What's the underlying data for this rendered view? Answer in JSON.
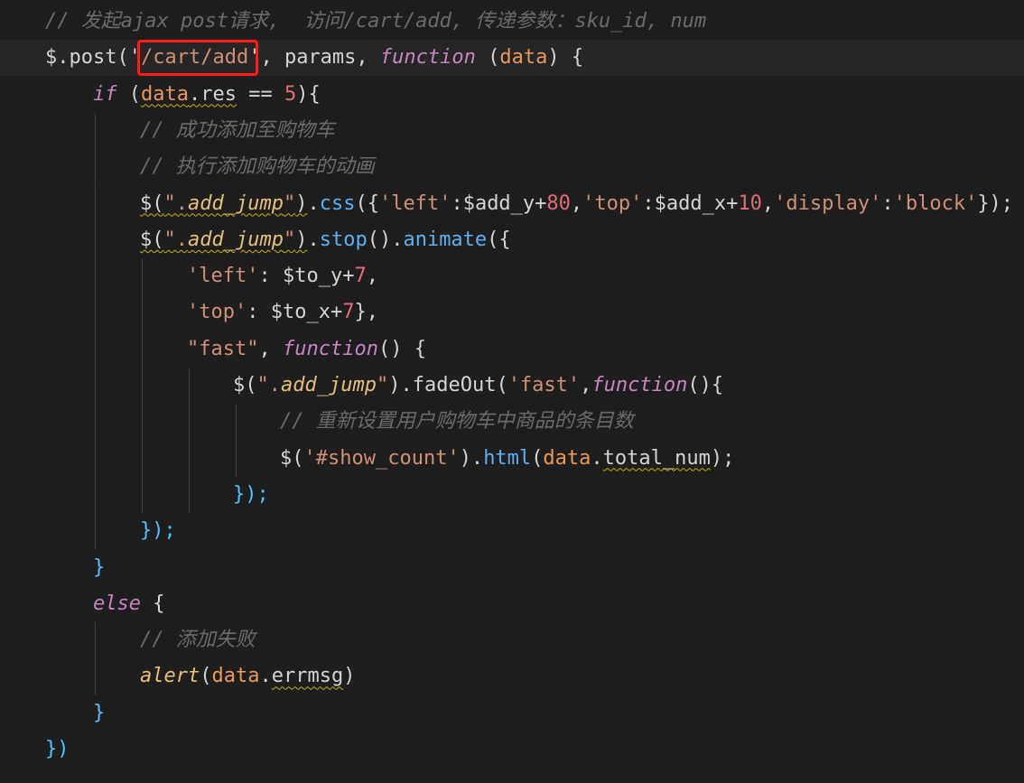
{
  "editor": {
    "highlighted_text": "/cart/add",
    "lines": [
      {
        "indent": 1,
        "tokens": [
          {
            "t": "// 发起ajax post请求,  访问/cart/add, 传递参数：sku_id, num",
            "c": "comment"
          }
        ]
      },
      {
        "indent": 1,
        "current": true,
        "tokens": [
          {
            "t": "$.",
            "c": "plain"
          },
          {
            "t": "post",
            "c": "plain"
          },
          {
            "t": "('",
            "c": "punct"
          },
          {
            "t": "/cart/add",
            "c": "string"
          },
          {
            "t": "'",
            "c": "punct"
          },
          {
            "t": ", params, ",
            "c": "plain"
          },
          {
            "t": "function",
            "c": "func-kw"
          },
          {
            "t": " (",
            "c": "plain"
          },
          {
            "t": "data",
            "c": "param"
          },
          {
            "t": ") {",
            "c": "plain"
          }
        ]
      },
      {
        "indent": 2,
        "tokens": [
          {
            "t": "if",
            "c": "keyword"
          },
          {
            "t": " (",
            "c": "plain"
          },
          {
            "t": "data",
            "c": "param",
            "sq": true
          },
          {
            "t": ".",
            "c": "plain",
            "sq": true
          },
          {
            "t": "res",
            "c": "plain",
            "sq": true
          },
          {
            "t": " == ",
            "c": "op"
          },
          {
            "t": "5",
            "c": "number"
          },
          {
            "t": "){",
            "c": "plain"
          }
        ]
      },
      {
        "indent": 3,
        "tokens": [
          {
            "t": "// 成功添加至购物车",
            "c": "comment"
          }
        ]
      },
      {
        "indent": 3,
        "tokens": [
          {
            "t": "// 执行添加购物车的动画",
            "c": "comment"
          }
        ]
      },
      {
        "indent": 3,
        "tokens": [
          {
            "t": "$(",
            "c": "plain",
            "sq": true
          },
          {
            "t": "\".",
            "c": "string",
            "sq": true
          },
          {
            "t": "add_jump",
            "c": "selector",
            "sq": true
          },
          {
            "t": "\"",
            "c": "string",
            "sq": true
          },
          {
            "t": ")",
            "c": "plain",
            "sq": true
          },
          {
            "t": ".",
            "c": "plain"
          },
          {
            "t": "css",
            "c": "method"
          },
          {
            "t": "({",
            "c": "plain"
          },
          {
            "t": "'left'",
            "c": "string"
          },
          {
            "t": ":$add_y+",
            "c": "plain"
          },
          {
            "t": "80",
            "c": "number"
          },
          {
            "t": ",",
            "c": "plain"
          },
          {
            "t": "'top'",
            "c": "string"
          },
          {
            "t": ":$add_x+",
            "c": "plain"
          },
          {
            "t": "10",
            "c": "number"
          },
          {
            "t": ",",
            "c": "plain"
          },
          {
            "t": "'display'",
            "c": "string"
          },
          {
            "t": ":",
            "c": "plain"
          },
          {
            "t": "'block'",
            "c": "string"
          },
          {
            "t": "});",
            "c": "plain"
          }
        ]
      },
      {
        "indent": 3,
        "tokens": [
          {
            "t": "$(",
            "c": "plain",
            "sq": true
          },
          {
            "t": "\".",
            "c": "string",
            "sq": true
          },
          {
            "t": "add_jump",
            "c": "selector",
            "sq": true
          },
          {
            "t": "\"",
            "c": "string",
            "sq": true
          },
          {
            "t": ")",
            "c": "plain",
            "sq": true
          },
          {
            "t": ".",
            "c": "plain"
          },
          {
            "t": "stop",
            "c": "method"
          },
          {
            "t": "().",
            "c": "plain"
          },
          {
            "t": "animate",
            "c": "method"
          },
          {
            "t": "({",
            "c": "plain"
          }
        ]
      },
      {
        "indent": 4,
        "tokens": [
          {
            "t": "'left'",
            "c": "string"
          },
          {
            "t": ": $to_y+",
            "c": "plain"
          },
          {
            "t": "7",
            "c": "number"
          },
          {
            "t": ",",
            "c": "plain"
          }
        ]
      },
      {
        "indent": 4,
        "tokens": [
          {
            "t": "'top'",
            "c": "string"
          },
          {
            "t": ": $to_x+",
            "c": "plain"
          },
          {
            "t": "7",
            "c": "number"
          },
          {
            "t": "},",
            "c": "plain"
          }
        ]
      },
      {
        "indent": 4,
        "tokens": [
          {
            "t": "\"fast\"",
            "c": "string"
          },
          {
            "t": ", ",
            "c": "plain"
          },
          {
            "t": "function",
            "c": "func-kw"
          },
          {
            "t": "() {",
            "c": "plain"
          }
        ]
      },
      {
        "indent": 5,
        "tokens": [
          {
            "t": "$(",
            "c": "plain"
          },
          {
            "t": "\".",
            "c": "string"
          },
          {
            "t": "add_jump",
            "c": "selector"
          },
          {
            "t": "\"",
            "c": "string"
          },
          {
            "t": ").",
            "c": "plain"
          },
          {
            "t": "fadeOut",
            "c": "plain"
          },
          {
            "t": "(",
            "c": "plain"
          },
          {
            "t": "'fast'",
            "c": "string"
          },
          {
            "t": ",",
            "c": "plain"
          },
          {
            "t": "function",
            "c": "func-kw"
          },
          {
            "t": "(){",
            "c": "plain"
          }
        ]
      },
      {
        "indent": 6,
        "tokens": [
          {
            "t": "// 重新设置用户购物车中商品的条目数",
            "c": "comment"
          }
        ]
      },
      {
        "indent": 6,
        "tokens": [
          {
            "t": "$(",
            "c": "plain"
          },
          {
            "t": "'#show_count'",
            "c": "string"
          },
          {
            "t": ").",
            "c": "plain"
          },
          {
            "t": "html",
            "c": "method"
          },
          {
            "t": "(",
            "c": "plain"
          },
          {
            "t": "data",
            "c": "param"
          },
          {
            "t": ".",
            "c": "plain"
          },
          {
            "t": "total_num",
            "c": "plain",
            "sq": true
          },
          {
            "t": ");",
            "c": "plain"
          }
        ]
      },
      {
        "indent": 5,
        "tokens": [
          {
            "t": "});",
            "c": "bracket"
          }
        ]
      },
      {
        "indent": 3,
        "tokens": [
          {
            "t": "});",
            "c": "bracket"
          }
        ]
      },
      {
        "indent": 2,
        "tokens": [
          {
            "t": "}",
            "c": "bracket"
          }
        ]
      },
      {
        "indent": 2,
        "tokens": [
          {
            "t": "else",
            "c": "keyword"
          },
          {
            "t": " {",
            "c": "plain"
          }
        ]
      },
      {
        "indent": 3,
        "tokens": [
          {
            "t": "// 添加失败",
            "c": "comment"
          }
        ]
      },
      {
        "indent": 3,
        "tokens": [
          {
            "t": "alert",
            "c": "alert"
          },
          {
            "t": "(",
            "c": "plain"
          },
          {
            "t": "data",
            "c": "param"
          },
          {
            "t": ".",
            "c": "plain"
          },
          {
            "t": "errmsg",
            "c": "plain",
            "sq": true
          },
          {
            "t": ")",
            "c": "plain"
          }
        ]
      },
      {
        "indent": 2,
        "tokens": [
          {
            "t": "}",
            "c": "bracket"
          }
        ]
      },
      {
        "indent": 1,
        "tokens": [
          {
            "t": "})",
            "c": "bracket"
          }
        ]
      }
    ]
  }
}
